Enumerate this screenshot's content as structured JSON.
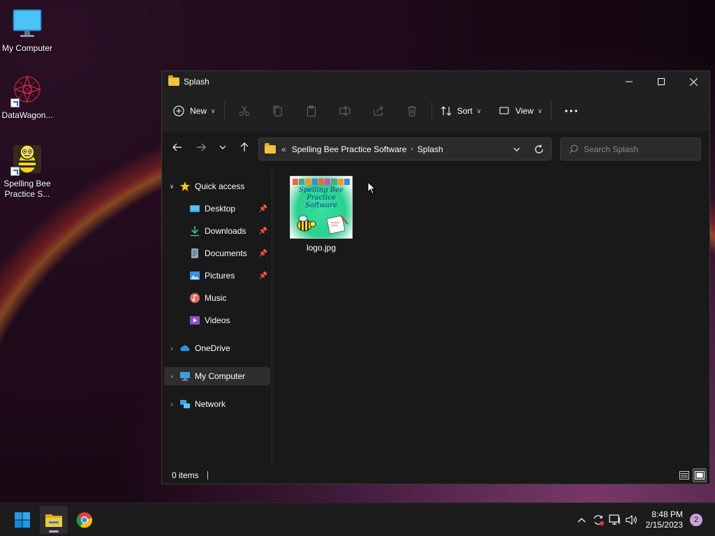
{
  "desktop": {
    "icons": [
      {
        "label": "My Computer",
        "icon": "monitor-icon"
      },
      {
        "label": "DataWagon...",
        "icon": "datawagon-app-icon"
      },
      {
        "label": "Spelling Bee Practice S...",
        "icon": "spelling-bee-app-icon"
      }
    ]
  },
  "window": {
    "title": "Splash",
    "commandbar": {
      "new_label": "New",
      "sort_label": "Sort",
      "view_label": "View"
    },
    "address": {
      "overflow": "«",
      "crumbs": [
        "Spelling Bee Practice Software",
        "Splash"
      ],
      "separator": "›"
    },
    "search": {
      "placeholder": "Search Splash"
    },
    "nav": {
      "quick_access": "Quick access",
      "items": [
        {
          "label": "Desktop",
          "pinned": true
        },
        {
          "label": "Downloads",
          "pinned": true
        },
        {
          "label": "Documents",
          "pinned": true
        },
        {
          "label": "Pictures",
          "pinned": true
        },
        {
          "label": "Music",
          "pinned": false
        },
        {
          "label": "Videos",
          "pinned": false
        }
      ],
      "onedrive": "OneDrive",
      "my_computer": "My Computer",
      "network": "Network"
    },
    "files": [
      {
        "name": "logo.jpg",
        "thumbnail_text": {
          "line1": "Spelling Bee",
          "line2": "Practice",
          "line3": "Software"
        }
      }
    ],
    "status": {
      "items_count": "0 items"
    }
  },
  "taskbar": {
    "clock_time": "8:48 PM",
    "clock_date": "2/15/2023",
    "notification_count": "2"
  },
  "colors": {
    "folder": "#f3c23c",
    "accent": "#c7a3d9",
    "window_bg": "#191919"
  }
}
